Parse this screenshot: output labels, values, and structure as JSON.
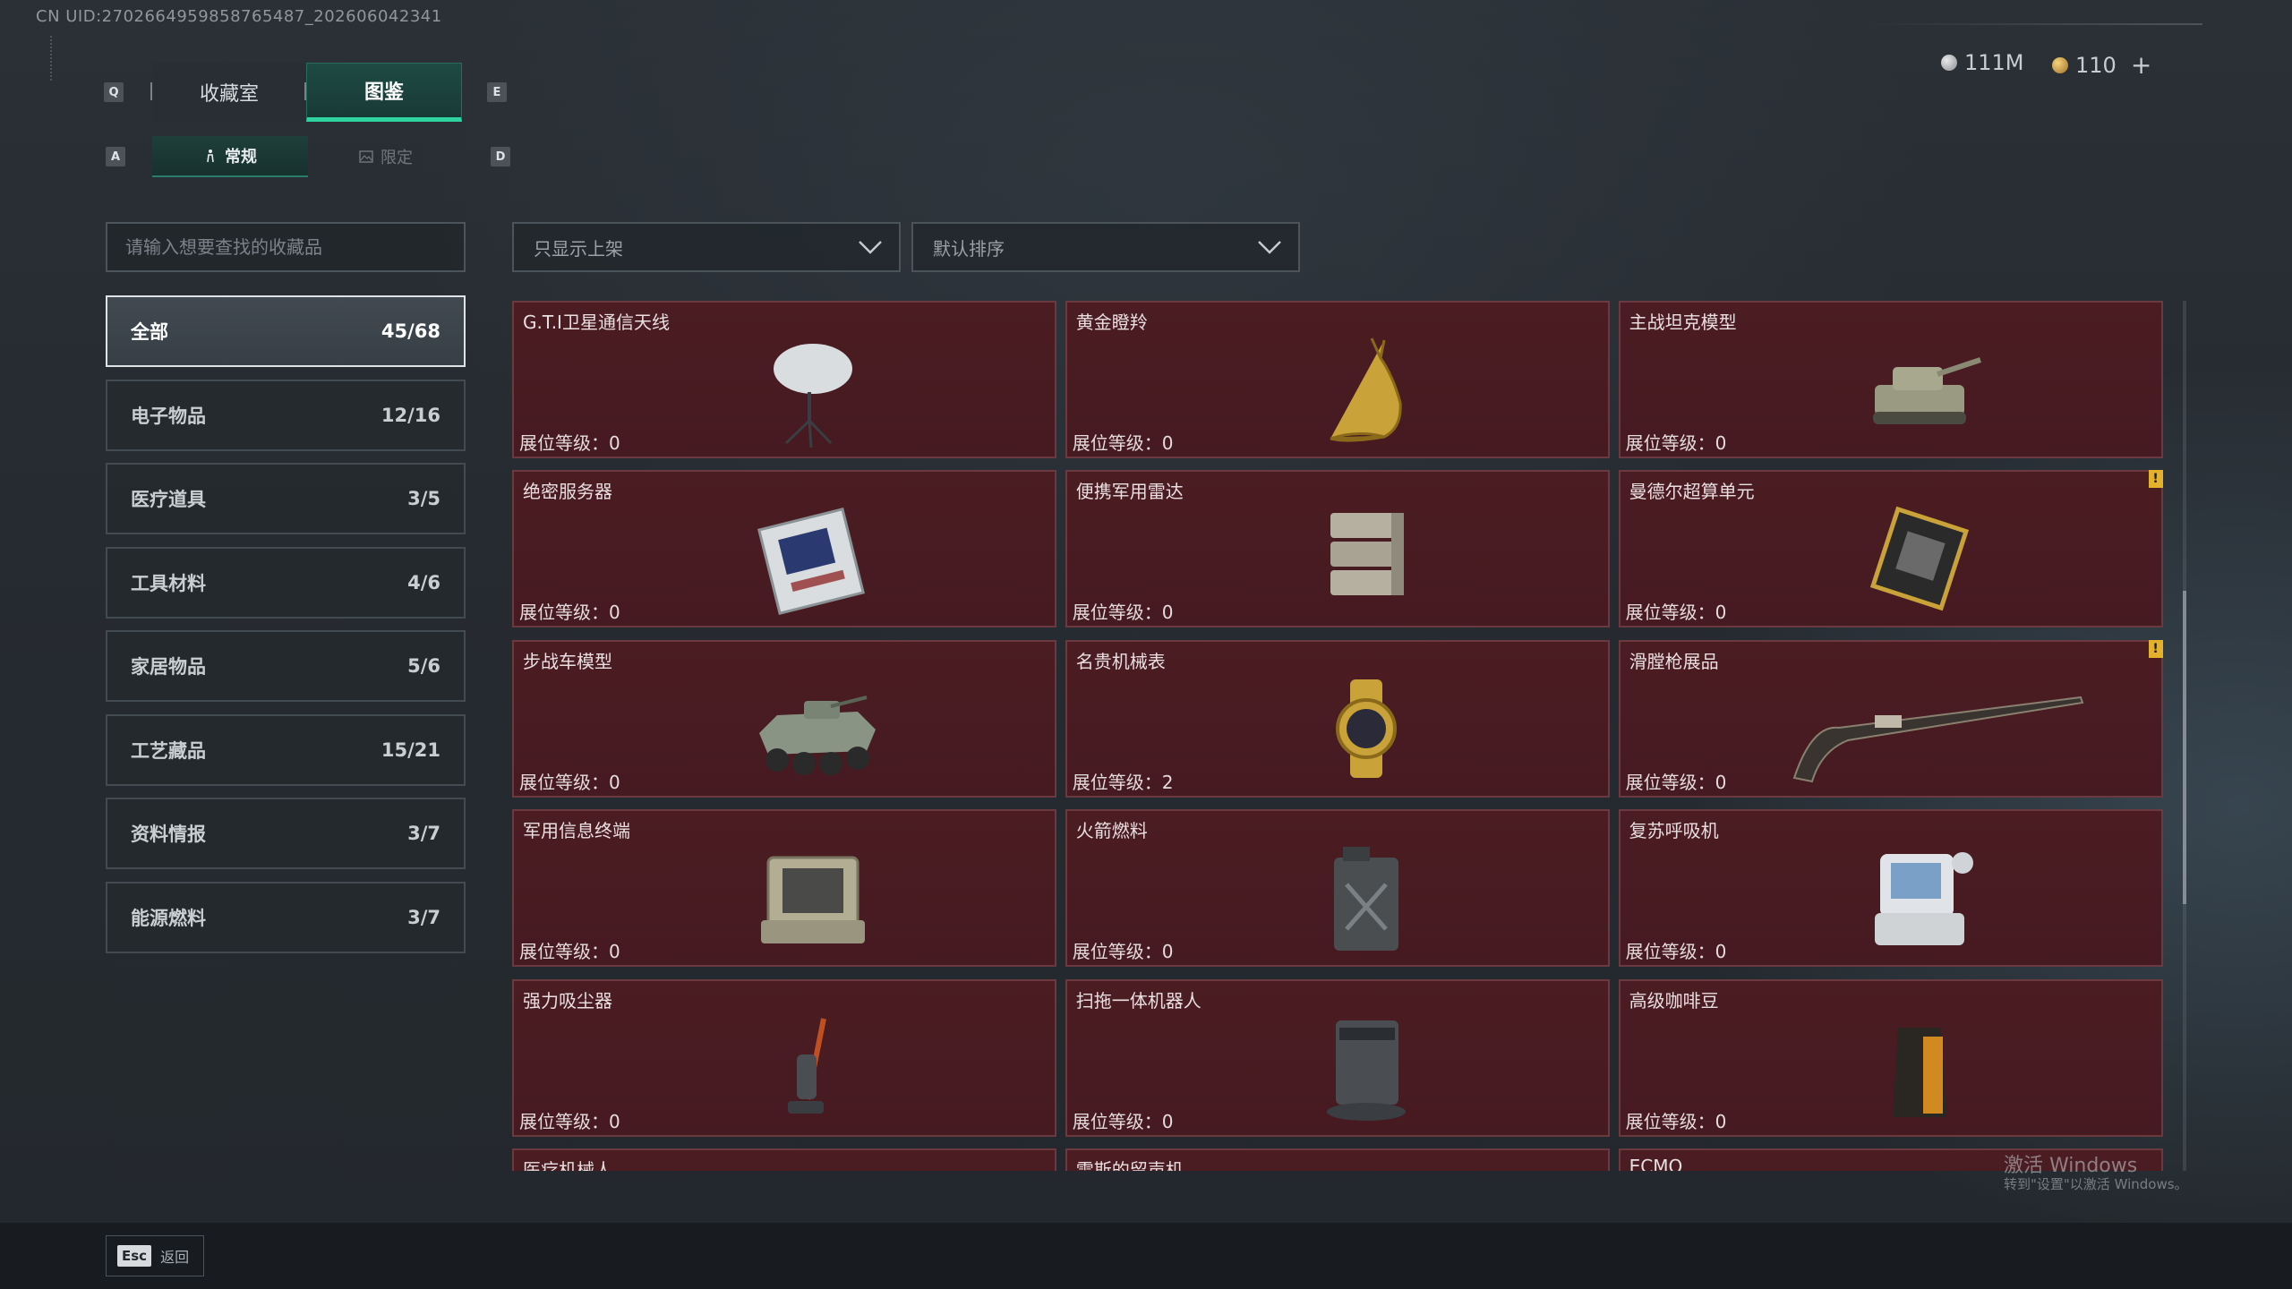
{
  "uid": "CN UID:2702664959858765487_202606042341",
  "currency": {
    "silver": {
      "value": "111M",
      "icon": "silver-coin-icon"
    },
    "gold": {
      "value": "110",
      "icon": "gold-coin-icon"
    },
    "add_label": "+"
  },
  "keys": {
    "prev_tab": "Q",
    "next_tab": "E",
    "prev_sub": "A",
    "next_sub": "D"
  },
  "tabs": [
    {
      "label": "收藏室",
      "active": false
    },
    {
      "label": "图鉴",
      "active": true
    }
  ],
  "subtabs": [
    {
      "label": "常规",
      "active": true,
      "icon": "figure-icon"
    },
    {
      "label": "限定",
      "active": false,
      "icon": "image-icon"
    }
  ],
  "search": {
    "placeholder": "请输入想要查找的收藏品"
  },
  "filters": {
    "shelf": "只显示上架",
    "sort": "默认排序"
  },
  "categories": [
    {
      "label": "全部",
      "count": "45/68"
    },
    {
      "label": "电子物品",
      "count": "12/16"
    },
    {
      "label": "医疗道具",
      "count": "3/5"
    },
    {
      "label": "工具材料",
      "count": "4/6"
    },
    {
      "label": "家居物品",
      "count": "5/6"
    },
    {
      "label": "工艺藏品",
      "count": "15/21"
    },
    {
      "label": "资料情报",
      "count": "3/7"
    },
    {
      "label": "能源燃料",
      "count": "3/7"
    }
  ],
  "level_prefix": "展位等级：",
  "items": [
    {
      "name": "G.T.I卫星通信天线",
      "level": "0",
      "icon": "satellite-dish-icon"
    },
    {
      "name": "黄金瞪羚",
      "level": "0",
      "icon": "gold-gazelle-icon"
    },
    {
      "name": "主战坦克模型",
      "level": "0",
      "icon": "tank-model-icon"
    },
    {
      "name": "绝密服务器",
      "level": "0",
      "icon": "server-icon"
    },
    {
      "name": "便携军用雷达",
      "level": "0",
      "icon": "radar-icon"
    },
    {
      "name": "曼德尔超算单元",
      "level": "0",
      "icon": "supercompute-unit-icon",
      "warn": "!"
    },
    {
      "name": "步战车模型",
      "level": "0",
      "icon": "ifv-model-icon"
    },
    {
      "name": "名贵机械表",
      "level": "2",
      "icon": "watch-icon"
    },
    {
      "name": "滑膛枪展品",
      "level": "0",
      "icon": "musket-icon",
      "warn": "!"
    },
    {
      "name": "军用信息终端",
      "level": "0",
      "icon": "terminal-case-icon"
    },
    {
      "name": "火箭燃料",
      "level": "0",
      "icon": "fuel-canister-icon"
    },
    {
      "name": "复苏呼吸机",
      "level": "0",
      "icon": "ventilator-icon"
    },
    {
      "name": "强力吸尘器",
      "level": "0",
      "icon": "vacuum-cleaner-icon"
    },
    {
      "name": "扫拖一体机器人",
      "level": "0",
      "icon": "mop-robot-icon"
    },
    {
      "name": "高级咖啡豆",
      "level": "0",
      "icon": "coffee-bag-icon"
    },
    {
      "name": "医疗机械人",
      "icon": "medical-robot-icon"
    },
    {
      "name": "雷斯的留声机",
      "icon": "gramophone-icon"
    },
    {
      "name": "ECMO",
      "icon": "ecmo-icon"
    }
  ],
  "footer": {
    "esc_key": "Esc",
    "esc_label": "返回"
  },
  "watermark": {
    "title": "激活 Windows",
    "subtitle": "转到\"设置\"以激活 Windows。"
  }
}
